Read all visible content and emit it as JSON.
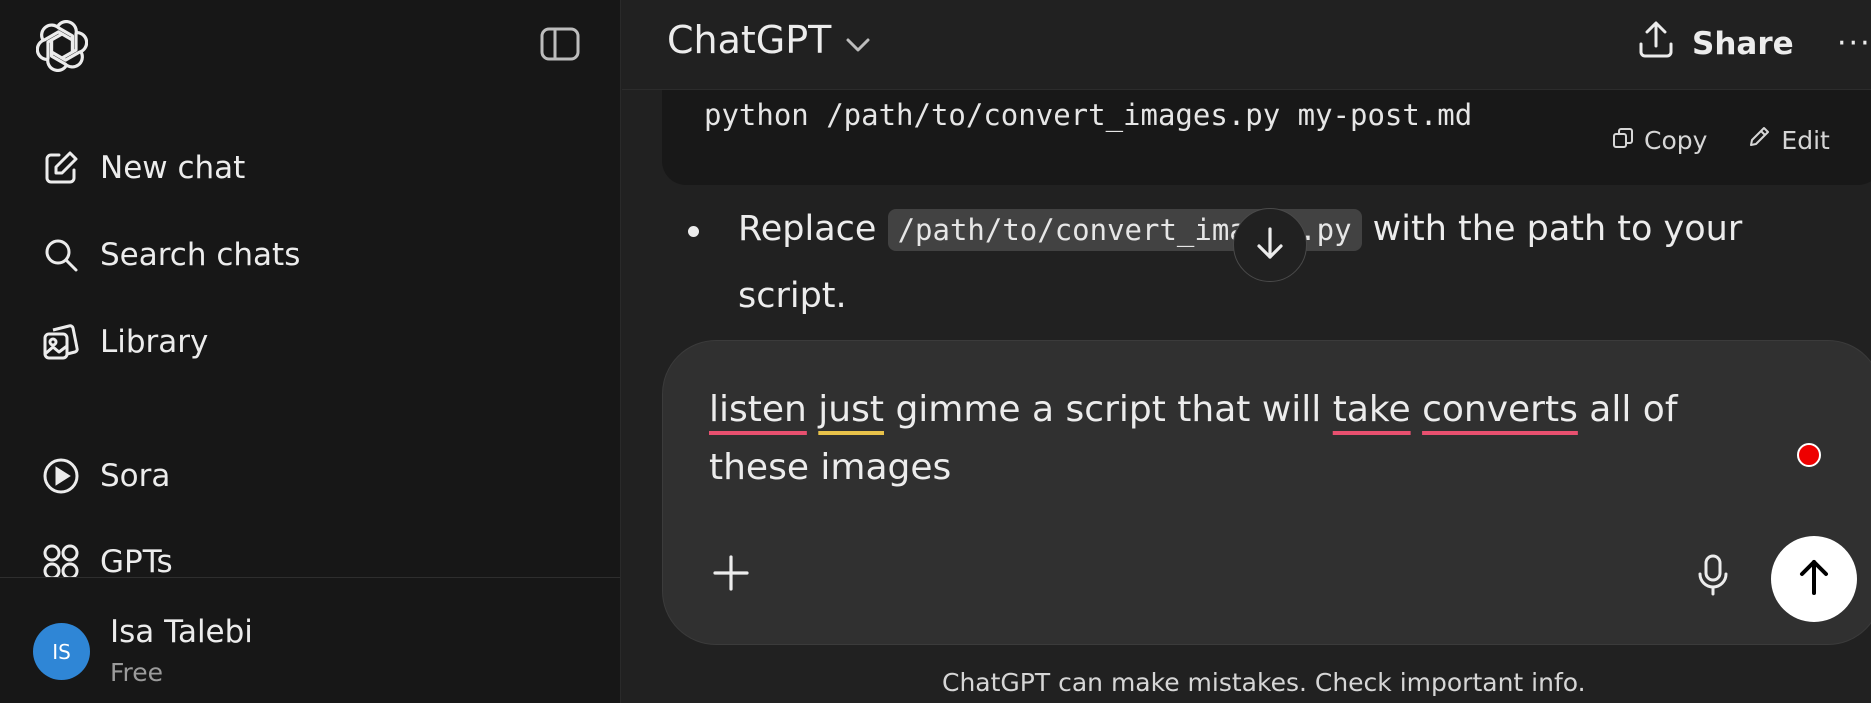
{
  "app": {
    "model_name": "ChatGPT"
  },
  "header": {
    "share_label": "Share",
    "more_label": "···"
  },
  "sidebar": {
    "items": [
      {
        "label": "New chat",
        "icon": "pencil-square-icon"
      },
      {
        "label": "Search chats",
        "icon": "search-icon"
      },
      {
        "label": "Library",
        "icon": "images-icon"
      },
      {
        "label": "Sora",
        "icon": "play-circle-icon"
      },
      {
        "label": "GPTs",
        "icon": "grid-icon"
      }
    ],
    "user": {
      "initials": "IS",
      "name": "Isa Talebi",
      "plan": "Free"
    }
  },
  "conversation": {
    "code_line": "python /path/to/convert_images.py my-post.md",
    "copy_label": "Copy",
    "edit_label": "Edit",
    "bullet": {
      "prefix": "Replace ",
      "code": "/path/to/convert_images.py",
      "suffix": " with the path to your script."
    }
  },
  "composer": {
    "words": [
      {
        "text": "listen",
        "spell": "red"
      },
      {
        "text": " ",
        "spell": ""
      },
      {
        "text": "just",
        "spell": "yellow"
      },
      {
        "text": " gimme a script that will ",
        "spell": ""
      },
      {
        "text": "take",
        "spell": "red"
      },
      {
        "text": " ",
        "spell": ""
      },
      {
        "text": "converts",
        "spell": "red"
      },
      {
        "text": " all of these images",
        "spell": ""
      }
    ]
  },
  "footer": {
    "disclaimer": "ChatGPT can make mistakes. Check important info."
  },
  "colors": {
    "sidebar_bg": "#171717",
    "main_bg": "#212121",
    "composer_bg": "#303030",
    "avatar": "#2f86d6",
    "spell_red": "#e8506f",
    "spell_yellow": "#e8c24a",
    "record": "#ee0000"
  }
}
